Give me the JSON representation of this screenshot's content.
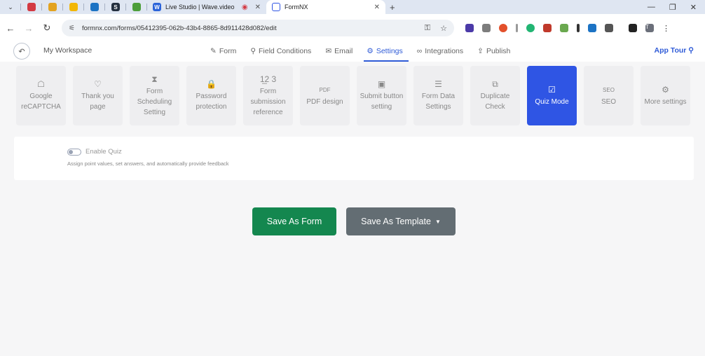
{
  "browser": {
    "tabs": [
      {
        "icon": "tab-icon-1",
        "color": "#d33a43"
      },
      {
        "icon": "tab-icon-2",
        "color": "#e3a321"
      },
      {
        "icon": "tab-icon-3",
        "color": "#f2b707"
      },
      {
        "icon": "tab-icon-4",
        "color": "#1c73c4"
      },
      {
        "icon": "tab-icon-5",
        "color": "#24303f",
        "letter": "S"
      },
      {
        "icon": "tab-icon-6",
        "color": "#4d9e3b"
      }
    ],
    "tab_wavevideo": {
      "label": "Live Studio | Wave.video",
      "letter": "W"
    },
    "tab_active": {
      "label": "FormNX"
    },
    "url": "formnx.com/forms/05412395-062b-43b4-8865-8d911428d082/edit",
    "profile_letter": "T"
  },
  "nav": {
    "workspace": "My Workspace",
    "items": [
      {
        "label": "Form",
        "icon": "✎"
      },
      {
        "label": "Field Conditions",
        "icon": "⚲"
      },
      {
        "label": "Email",
        "icon": "✉"
      },
      {
        "label": "Settings",
        "icon": "⚙"
      },
      {
        "label": "Integrations",
        "icon": "∞"
      },
      {
        "label": "Publish",
        "icon": "⇪"
      }
    ],
    "app_tour": "App Tour"
  },
  "cards": [
    {
      "label": "Google reCAPTCHA",
      "icon": "☖"
    },
    {
      "label": "Thank you page",
      "icon": "♡"
    },
    {
      "label": "Form Scheduling Setting",
      "icon": "⧗"
    },
    {
      "label": "Password protection",
      "icon": "🔒"
    },
    {
      "label": "Form submission reference",
      "icon": "1̲2 3"
    },
    {
      "label": "PDF design",
      "icon": "PDF"
    },
    {
      "label": "Submit button setting",
      "icon": "▣"
    },
    {
      "label": "Form Data Settings",
      "icon": "☰"
    },
    {
      "label": "Duplicate Check",
      "icon": "⧉"
    },
    {
      "label": "Quiz Mode",
      "icon": "☑",
      "active": true
    },
    {
      "label": "SEO",
      "icon": "SEO"
    },
    {
      "label": "More settings",
      "icon": "⚙"
    }
  ],
  "quiz": {
    "toggle_label": "Enable Quiz",
    "description": "Assign point values, set answers, and automatically provide feedback",
    "enabled": false
  },
  "buttons": {
    "save_form": "Save As Form",
    "save_template": "Save As Template"
  },
  "colors": {
    "accent": "#2f55e4",
    "save_form": "#14874f",
    "save_template": "#636d73"
  }
}
